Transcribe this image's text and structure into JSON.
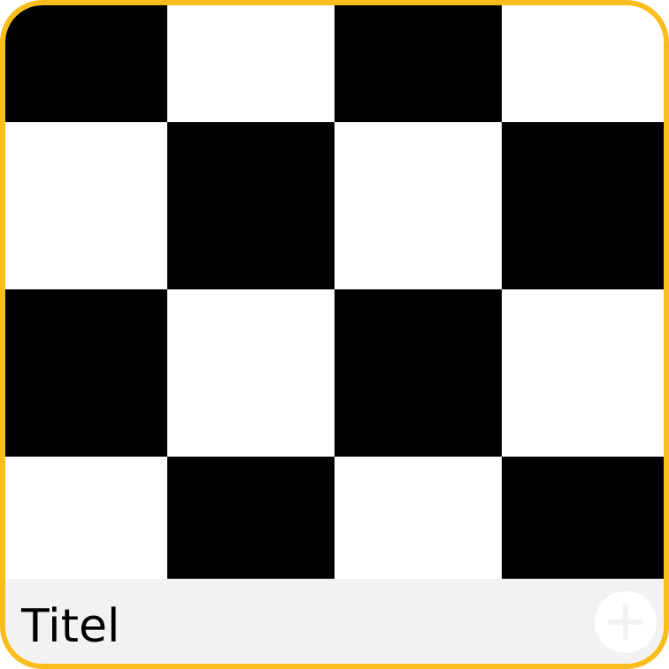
{
  "card": {
    "title": "Titel",
    "accent_color": "#F9BE1B",
    "footer_color": "#F2F2F2",
    "image": {
      "pattern": "checkerboard",
      "cells": [
        [
          "black",
          "white",
          "black",
          "white"
        ],
        [
          "white",
          "black",
          "white",
          "black"
        ],
        [
          "black",
          "white",
          "black",
          "white"
        ],
        [
          "white",
          "black",
          "white",
          "black"
        ]
      ]
    },
    "add_button": {
      "icon": "plus-icon",
      "color": "#F2F2F2"
    }
  }
}
